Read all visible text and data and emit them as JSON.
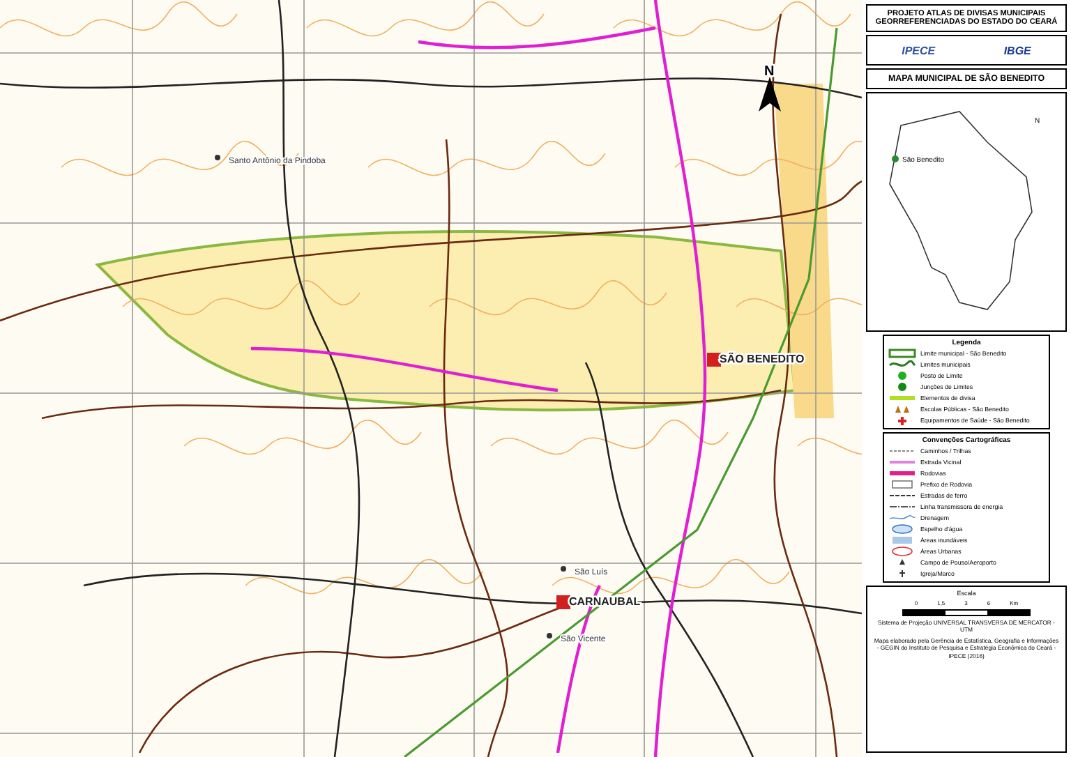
{
  "title": {
    "line1": "PROJETO ATLAS DE DIVISAS MUNICIPAIS",
    "line2": "GEORREFERENCIADAS DO ESTADO DO CEARÁ"
  },
  "logos": [
    "IPECE",
    "IBGE"
  ],
  "map_title": "MAPA MUNICIPAL DE SÃO BENEDITO",
  "locator": {
    "label": "São Benedito",
    "north": "N"
  },
  "map": {
    "north": "N",
    "places": [
      {
        "name": "Santo Antônio da Pindoba",
        "kind": "village"
      },
      {
        "name": "SÃO BENEDITO",
        "kind": "seat"
      },
      {
        "name": "São Luís",
        "kind": "village"
      },
      {
        "name": "CARNAUBAL",
        "kind": "seat"
      },
      {
        "name": "São Vicente",
        "kind": "village"
      }
    ]
  },
  "legend": {
    "title": "Legenda",
    "items": [
      {
        "label": "Limite municipal - São Benedito",
        "kind": "main-boundary"
      },
      {
        "label": "Limites municipais",
        "kind": "boundary"
      },
      {
        "label": "Posto de Limite",
        "kind": "post"
      },
      {
        "label": "Junções de Limites",
        "kind": "junction"
      },
      {
        "label": "Elementos de divisa",
        "kind": "divisa"
      },
      {
        "label": "Escolas Públicas - São Benedito",
        "kind": "school"
      },
      {
        "label": "Equipamentos de Saúde - São Benedito",
        "kind": "health"
      }
    ]
  },
  "conventions": {
    "title": "Convenções Cartográficas",
    "items": [
      {
        "label": "Caminhos / Trilhas",
        "kind": "trail"
      },
      {
        "label": "Estrada Vicinal",
        "kind": "vicinal"
      },
      {
        "label": "Rodovias",
        "kind": "highway"
      },
      {
        "label": "Prefixo de Rodovia",
        "kind": "prefix"
      },
      {
        "label": "Estradas de ferro",
        "kind": "rail"
      },
      {
        "label": "Linha transmissora de energia",
        "kind": "power"
      },
      {
        "label": "Drenagem",
        "kind": "drainage"
      },
      {
        "label": "Espelho d'água",
        "kind": "water"
      },
      {
        "label": "Áreas inundáveis",
        "kind": "flood"
      },
      {
        "label": "Áreas Urbanas",
        "kind": "urban"
      },
      {
        "label": "Campo de Pouso/Aeroporto",
        "kind": "airfield"
      },
      {
        "label": "Igreja/Marco",
        "kind": "church"
      }
    ]
  },
  "scale": {
    "title": "Escala",
    "ticks": [
      "0",
      "1,5",
      "3",
      "6"
    ],
    "unit": "Km"
  },
  "projection": "Sistema de Projeção UNIVERSAL TRANSVERSA DE MERCATOR - UTM",
  "credit": "Mapa elaborado pela Gerência de Estatística, Geografia e Informações - GEGIN do Instituto de Pesquisa e Estratégia Econômica do Ceará - IPECE (2016)"
}
